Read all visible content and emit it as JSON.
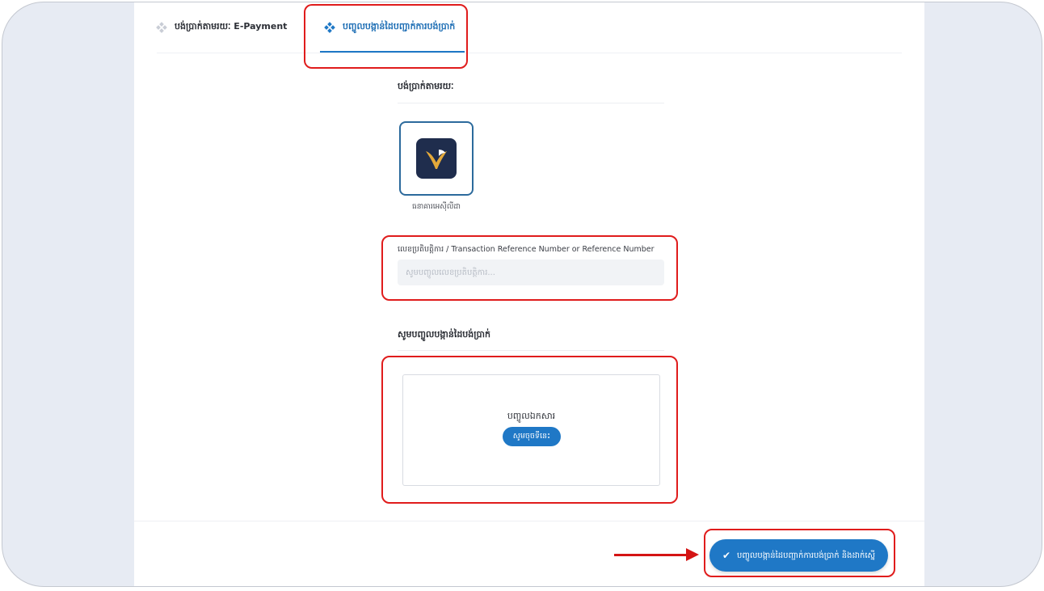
{
  "tabs": [
    {
      "label": "បង់ប្រាក់តាមរយៈ E-Payment",
      "active": false
    },
    {
      "label": "បញ្ចូលបង្កាន់ដៃបញ្ជាក់ការបង់ប្រាក់",
      "active": true
    }
  ],
  "payment_section": {
    "title": "បង់ប្រាក់តាមរយៈ"
  },
  "bank": {
    "name": "ធនាគារអេស៊ីលីដា",
    "logo": "acleda-bank-logo"
  },
  "reference": {
    "label": "លេខប្រតិបត្តិការ / Transaction Reference Number or Reference Number",
    "placeholder": "សូមបញ្ចូលលេខប្រតិបត្តិការ...",
    "value": ""
  },
  "upload": {
    "title": "សូមបញ្ចូលបង្កាន់ដៃបង់ប្រាក់",
    "drop_label": "បញ្ចូលឯកសារ",
    "choose_label": "សូមចុចទីនេះ"
  },
  "submit": {
    "label": "បញ្ចូលបង្កាន់ដៃបញ្ជាក់ការបង់ប្រាក់ និងដាក់ស្នើ",
    "icon": "double-check-icon"
  },
  "colors": {
    "accent": "#1f78c6",
    "highlight": "#e01c1c",
    "bank_border": "#2c6a9c",
    "background": "#e7ebf3"
  }
}
